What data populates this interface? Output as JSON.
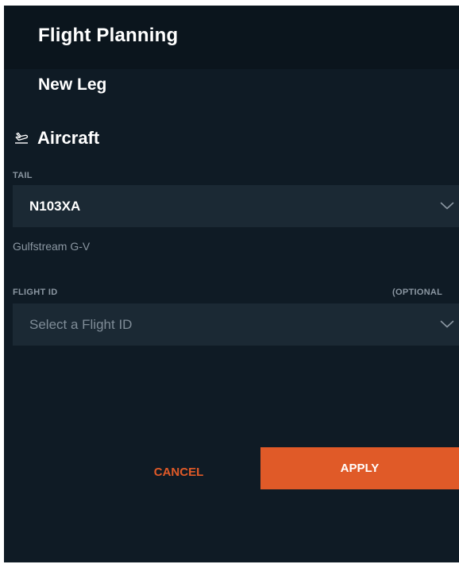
{
  "header": {
    "title": "Flight Planning"
  },
  "form": {
    "subtitle": "New Leg",
    "section": {
      "title": "Aircraft",
      "icon": "airplane-icon"
    },
    "tail": {
      "label": "TAIL",
      "value": "N103XA",
      "helper": "Gulfstream G-V",
      "icon": "chevron-down-icon"
    },
    "flight_id": {
      "label": "FLIGHT ID",
      "optional_label": "(OPTIONAL",
      "placeholder": "Select a Flight ID",
      "icon": "chevron-down-icon"
    }
  },
  "actions": {
    "cancel_label": "CANCEL",
    "apply_label": "APPLY"
  },
  "colors": {
    "panel_background": "#0f1b25",
    "header_background": "#0b151d",
    "field_background": "#1b2934",
    "accent": "#e05a28",
    "muted_text": "#8b97a2",
    "text": "#ffffff"
  }
}
